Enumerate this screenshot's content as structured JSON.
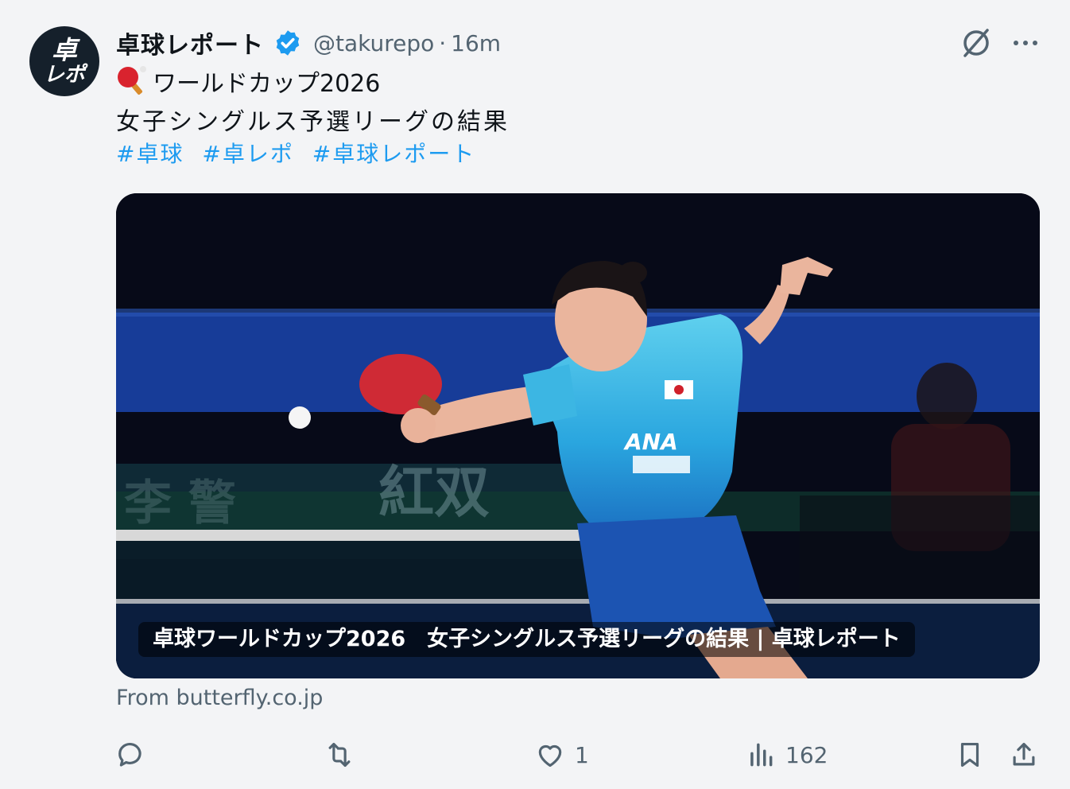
{
  "post": {
    "avatar_text": [
      "卓",
      "レポ"
    ],
    "display_name": "卓球レポート",
    "handle": "@takurepo",
    "separator": "·",
    "time": "16m",
    "line1": "ワールドカップ2026",
    "line2": "女子シングルス予選リーグの結果",
    "hashtags": [
      "#卓球",
      "#卓レポ",
      "#卓球レポート"
    ]
  },
  "card": {
    "caption": "卓球ワールドカップ2026　女子シングルス予選リーグの結果 | 卓球レポート",
    "source": "From butterfly.co.jp",
    "jersey_text": "ANA"
  },
  "actions": {
    "reply_count": "",
    "repost_count": "",
    "like_count": "1",
    "views_count": "162"
  },
  "colors": {
    "accent": "#1d9bf0",
    "muted": "#536471",
    "background": "#f3f4f6"
  },
  "icons": [
    "verified-badge-icon",
    "grok-icon",
    "more-icon",
    "ping-pong-paddle-icon",
    "reply-icon",
    "repost-icon",
    "like-icon",
    "views-icon",
    "bookmark-icon",
    "share-icon"
  ]
}
